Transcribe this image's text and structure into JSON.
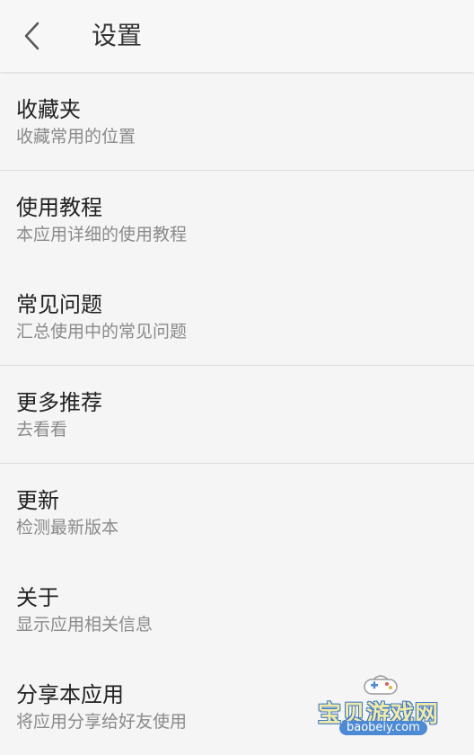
{
  "header": {
    "back_icon": "chevron-left-icon",
    "title": "设置"
  },
  "settings": {
    "items": [
      {
        "id": "favorites",
        "title": "收藏夹",
        "subtitle": "收藏常用的位置"
      },
      {
        "id": "tutorial",
        "title": "使用教程",
        "subtitle": "本应用详细的使用教程"
      },
      {
        "id": "faq",
        "title": "常见问题",
        "subtitle": "汇总使用中的常见问题"
      },
      {
        "id": "more-recommendations",
        "title": "更多推荐",
        "subtitle": "去看看"
      },
      {
        "id": "update",
        "title": "更新",
        "subtitle": "检测最新版本"
      },
      {
        "id": "about",
        "title": "关于",
        "subtitle": "显示应用相关信息"
      },
      {
        "id": "share",
        "title": "分享本应用",
        "subtitle": "将应用分享给好友使用"
      }
    ]
  },
  "watermark": {
    "title": "宝贝游戏网",
    "url": "baobeiy.com",
    "icon": "gamepad-icon"
  },
  "colors": {
    "background": "#f5f5f5",
    "appbar": "#f7f7f7",
    "divider": "#dcdcdc",
    "title_text": "#222222",
    "subtitle_text": "#8a8a8a"
  }
}
